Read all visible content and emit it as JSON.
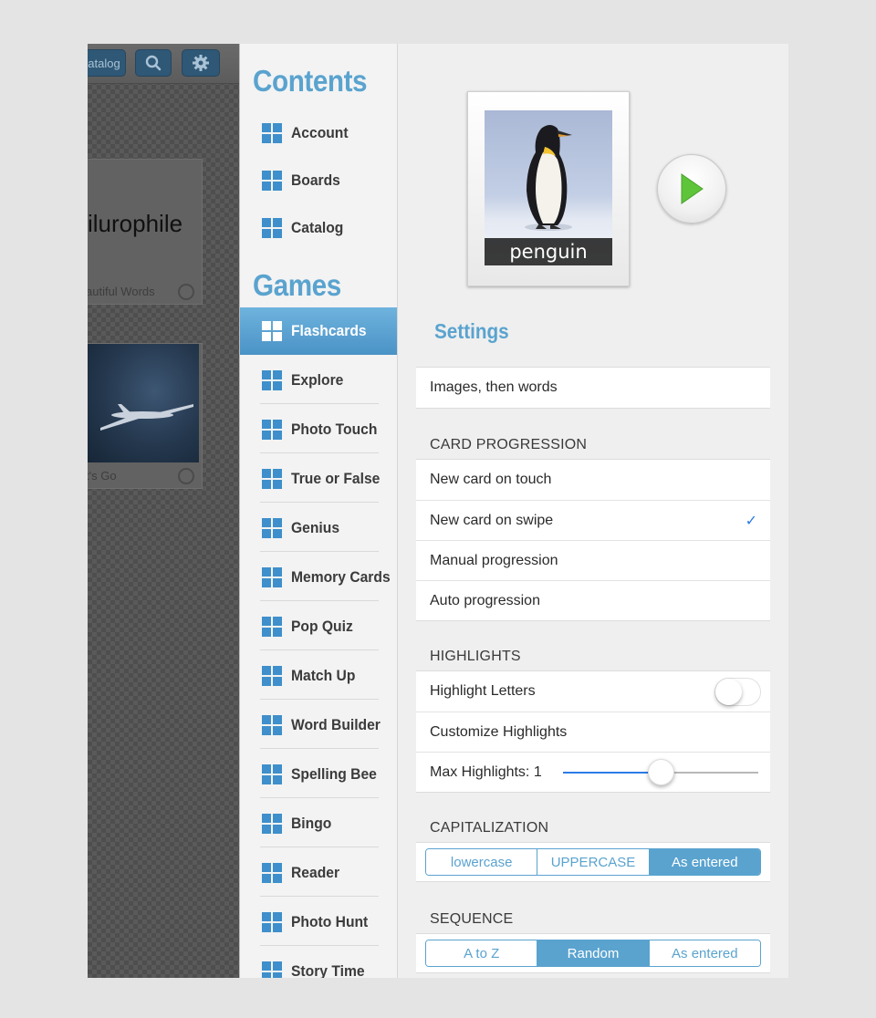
{
  "background": {
    "toolbar": {
      "catalog_label": "atalog"
    },
    "card1": {
      "word": "ilurophile",
      "subtitle": "autiful Words"
    },
    "card2": {
      "subtitle": "t's Go"
    }
  },
  "sidebar": {
    "contents_title": "Contents",
    "contents_items": [
      {
        "label": "Account"
      },
      {
        "label": "Boards"
      },
      {
        "label": "Catalog"
      }
    ],
    "games_title": "Games",
    "games_items": [
      {
        "label": "Flashcards",
        "active": true
      },
      {
        "label": "Explore"
      },
      {
        "label": "Photo Touch"
      },
      {
        "label": "True or False"
      },
      {
        "label": "Genius"
      },
      {
        "label": "Memory Cards"
      },
      {
        "label": "Pop Quiz"
      },
      {
        "label": "Match Up"
      },
      {
        "label": "Word Builder"
      },
      {
        "label": "Spelling Bee"
      },
      {
        "label": "Bingo"
      },
      {
        "label": "Reader"
      },
      {
        "label": "Photo Hunt"
      },
      {
        "label": "Story Time"
      }
    ]
  },
  "panel": {
    "card_label": "penguin",
    "settings_title": "Settings",
    "display_mode": "Images, then words",
    "card_progression": {
      "header": "CARD PROGRESSION",
      "options": [
        "New card on touch",
        "New card on swipe",
        "Manual progression",
        "Auto progression"
      ],
      "selected_index": 1
    },
    "highlights": {
      "header": "HIGHLIGHTS",
      "highlight_letters_label": "Highlight Letters",
      "highlight_letters_on": false,
      "customize_label": "Customize Highlights",
      "max_label": "Max Highlights: 1",
      "max_value_fraction": 0.5
    },
    "capitalization": {
      "header": "CAPITALIZATION",
      "options": [
        "lowercase",
        "UPPERCASE",
        "As entered"
      ],
      "selected_index": 2
    },
    "sequence": {
      "header": "SEQUENCE",
      "options": [
        "A to Z",
        "Random",
        "As entered"
      ],
      "selected_index": 1
    }
  },
  "colors": {
    "accent": "#5aa3cf",
    "icon_blue": "#3e8fcb",
    "check_blue": "#2c7be5",
    "play_green": "#5ec43a"
  }
}
